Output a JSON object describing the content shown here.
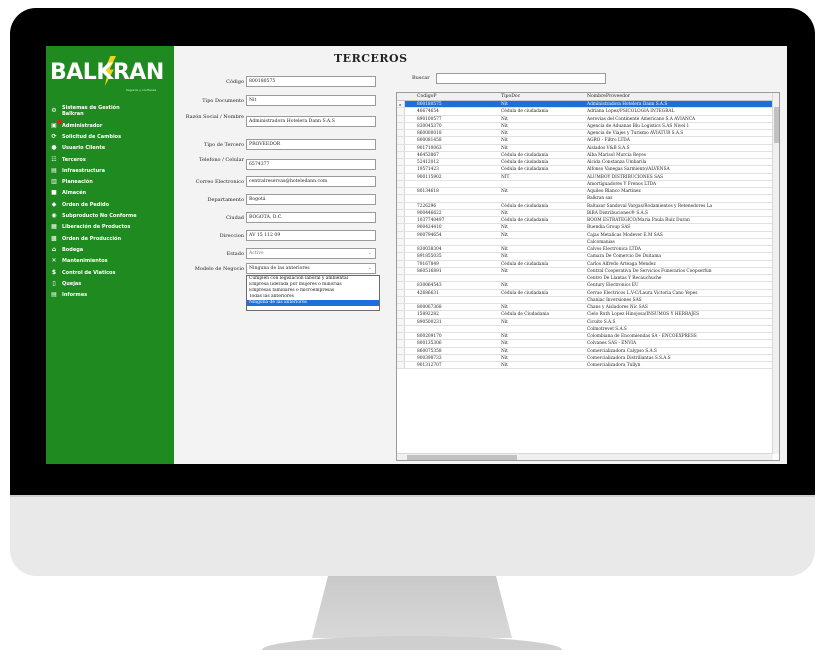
{
  "brand": {
    "name": "BALKRAN",
    "tagline": "Seguros y confianza"
  },
  "sidebar": {
    "items": [
      {
        "label": "Sistemas de Gestión Balkran",
        "icon": "gear-globe-icon"
      },
      {
        "label": "Administrador",
        "icon": "admin-icon"
      },
      {
        "label": "Solicitud de Cambios",
        "icon": "refresh-icon"
      },
      {
        "label": "Usuario Cliente",
        "icon": "user-icon"
      },
      {
        "label": "Terceros",
        "icon": "people-icon"
      },
      {
        "label": "Infraestructura",
        "icon": "server-icon"
      },
      {
        "label": "Planeación",
        "icon": "chart-icon"
      },
      {
        "label": "Almacén",
        "icon": "truck-icon"
      },
      {
        "label": "Orden de Pedido",
        "icon": "cart-icon"
      },
      {
        "label": "Subproducto No Conforme",
        "icon": "warning-icon"
      },
      {
        "label": "Liberación de Productos",
        "icon": "box-icon"
      },
      {
        "label": "Orden de Producción",
        "icon": "factory-icon"
      },
      {
        "label": "Bodega",
        "icon": "warehouse-icon"
      },
      {
        "label": "Mantenimientos",
        "icon": "wrench-icon"
      },
      {
        "label": "Control de Viaticos",
        "icon": "money-icon"
      },
      {
        "label": "Quejas",
        "icon": "document-icon"
      },
      {
        "label": "Informes",
        "icon": "report-icon"
      }
    ]
  },
  "form": {
    "title": "TERCEROS",
    "codigo_label": "Código",
    "codigo_value": "800180575",
    "tipo_doc_label": "Tipo Documento",
    "tipo_doc_value": "Nit",
    "razon_label": "Razón Social / Nombre",
    "razon_value": "Administradora Hotelera Dann S.A.S",
    "tipo_tercero_label": "Tipo de Tercero",
    "tipo_tercero_value": "PROVEEDOR",
    "telefono_label": "Telefono / Celular",
    "telefono_value": "6574377",
    "correo_label": "Correo Electronico",
    "correo_value": "centralreservas@hoteledann.com",
    "departamento_label": "Departamento",
    "departamento_value": "Bogotá",
    "ciudad_label": "Ciudad",
    "ciudad_value": "BOGOTÁ, D.C.",
    "direccion_label": "Direccion",
    "direccion_value": "AV 15 112 09",
    "estado_label": "Estado",
    "estado_value": "Activo",
    "modelo_label": "Modelo de Negocio",
    "modelo_value": "Ninguna de las anteriores",
    "modelo_options": [
      "Cumplen con legislacion laboral y ambiental",
      "Empresa liderada por mujeres o minorias",
      "Empresas familiares o microempresas",
      "Todas las anteriores",
      "Ninguna de las anteriores"
    ]
  },
  "search": {
    "label": "Buscar",
    "value": ""
  },
  "grid": {
    "columns": [
      "CodigoP",
      "TipoDoc",
      "NombreProveedor"
    ],
    "rows": [
      [
        "800180575",
        "Nit",
        "Administradora Hotelera Dann S.A.S"
      ],
      [
        "46674654",
        "Cédula de ciudadanía",
        "Adriana Lopez/PSICOLOGIA INTEGRAL"
      ],
      [
        "890100577",
        "Nit",
        "Aerovias del Continente Americano S.A AVIANCA"
      ],
      [
        "830045370",
        "Nit",
        "Agencia de Aduanas Blu Logistics S.AS Nivel 1"
      ],
      [
        "860000018",
        "Nit",
        "Agencia de Viajes y Turismo AVIATUR S.A.S"
      ],
      [
        "800081458",
        "Nit",
        "AGRO - Filtro LTDA"
      ],
      [
        "901710063",
        "Nit",
        "Aislados V&B S.A.S"
      ],
      [
        "46453867",
        "Cédula de ciudadanía",
        "Alba Marisol Murcia Reyes"
      ],
      [
        "52412012",
        "Cédula de ciudadanía",
        "Alcida Constanza Umbarila"
      ],
      [
        "19571423",
        "Cédula de ciudadanía",
        "Alfonso Vanegas Sarmiento/ALVENSA"
      ],
      [
        "900115902",
        "NIT",
        "ALUMBOY DISTRIBUCIONES SAS"
      ],
      [
        "",
        "",
        "Amortiguadores Y Frenos LTDA"
      ],
      [
        "80134618",
        "Nit",
        "Aquileo Blanco Martinez"
      ],
      [
        "",
        "",
        "Balkran sas"
      ],
      [
        "7226296",
        "Cédula de ciudadanía",
        "Baltazar Sandoval Vargas/Rodamientos y Retenedores La"
      ],
      [
        "900446622",
        "Nit",
        "BiBA Distribuciones® S.A.S"
      ],
      [
        "1037740497",
        "Cédula de ciudadanía",
        "BOOM ESTRATEGICO/Maria Paula Ruiz Duran"
      ],
      [
        "900424410",
        "Nit",
        "Buendia Group SAS"
      ],
      [
        "900794654",
        "Nit",
        "Cajas Metalicas Modever E.M SAS"
      ],
      [
        "",
        "",
        "Calcomanias"
      ],
      [
        "830038304",
        "Nit",
        "Calvos Electronica LTDA"
      ],
      [
        "891855035",
        "Nit",
        "Camara De Comercio De Duitama"
      ],
      [
        "79167849",
        "Cédula de ciudadanía",
        "Carlos Alfredo Arteaga Mendez"
      ],
      [
        "860516891",
        "Nit",
        "Central Cooperativa De Servicios Funerarios Coopserfun"
      ],
      [
        "",
        "",
        "Centro De Llantas Y Recauchuche"
      ],
      [
        "830064543",
        "Nit",
        "Century Electronics EU"
      ],
      [
        "42686631",
        "Cédula de ciudadanía",
        "Cerrao Electricos L.V-C/Laura Victoria Cano Yepes"
      ],
      [
        "",
        "",
        "Chaniac Inversiones SAS"
      ],
      [
        "800067368",
        "Nit",
        "Chans y Aisladores Nic SAS"
      ],
      [
        "15892282",
        "Cédula de Ciudadania",
        "Cielo Ruth Lopez Hinojosa/INSUMOS Y HERRAJES"
      ],
      [
        "890500231",
        "Nit",
        "Cicuito S.A.S"
      ],
      [
        "",
        "",
        "Colmotrevet  S.A.S"
      ],
      [
        "800209170",
        "Nit",
        "Colombiana de Encomiendas SA - ENCOEXPRESS"
      ],
      [
        "800135306",
        "Nit",
        "Colvanes SAS  - ENVIA"
      ],
      [
        "860075358",
        "Nit",
        "Comercializadora Calypso S.A.S"
      ],
      [
        "900398733",
        "Nit",
        "Comercializadora Distrillantas S.S.A.S"
      ],
      [
        "901312707",
        "Nit",
        "Comercializadora Tullyn"
      ]
    ]
  }
}
